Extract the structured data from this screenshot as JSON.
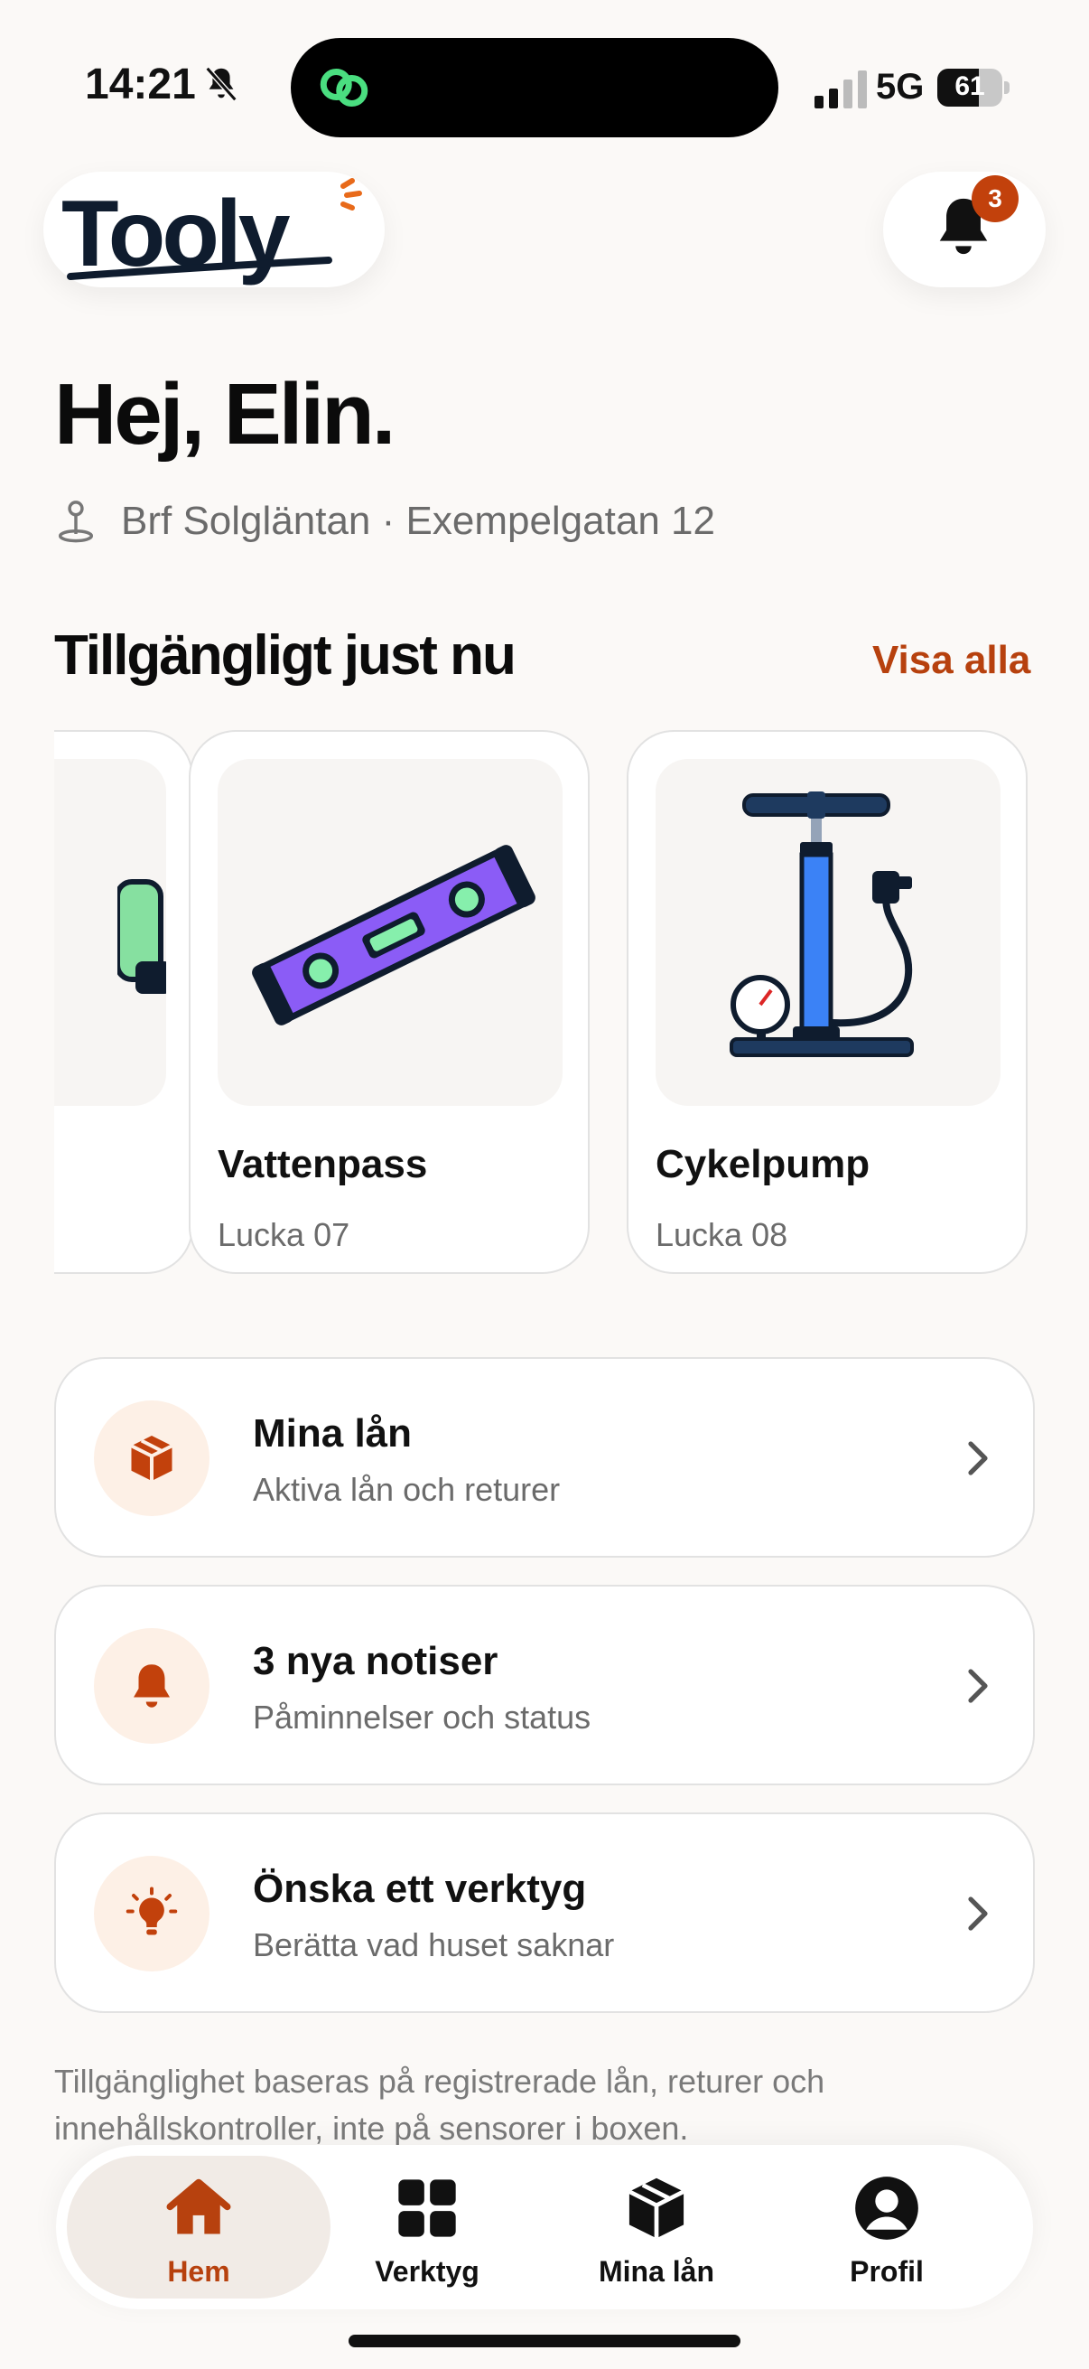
{
  "status_bar": {
    "time": "14:21",
    "network": "5G",
    "battery": "61"
  },
  "header": {
    "logo_text": "Tooly",
    "notification_count": "3"
  },
  "greeting": "Hej, Elin.",
  "address": "Brf Solgläntan · Exempelgatan 12",
  "available": {
    "title": "Tillgängligt just nu",
    "see_all": "Visa alla",
    "tools": [
      {
        "name": "Vattenpass",
        "location": "Lucka 07",
        "icon": "spirit-level"
      },
      {
        "name": "Cykelpump",
        "location": "Lucka 08",
        "icon": "bike-pump"
      }
    ]
  },
  "actions": [
    {
      "title": "Mina lån",
      "subtitle": "Aktiva lån och returer",
      "icon": "box-icon"
    },
    {
      "title": "3 nya notiser",
      "subtitle": "Påminnelser och status",
      "icon": "bell-icon"
    },
    {
      "title": "Önska ett verktyg",
      "subtitle": "Berätta vad huset saknar",
      "icon": "lightbulb-icon"
    }
  ],
  "footnote": "Tillgänglighet baseras på registrerade lån, returer och innehållskontroller, inte på sensorer i boxen.",
  "tabs": [
    {
      "label": "Hem",
      "active": true
    },
    {
      "label": "Verktyg",
      "active": false
    },
    {
      "label": "Mina lån",
      "active": false
    },
    {
      "label": "Profil",
      "active": false
    }
  ],
  "colors": {
    "accent": "#b7410e",
    "badge": "#c2410c",
    "icon_bg": "#fdf0e6",
    "background": "#fbf9f7"
  }
}
